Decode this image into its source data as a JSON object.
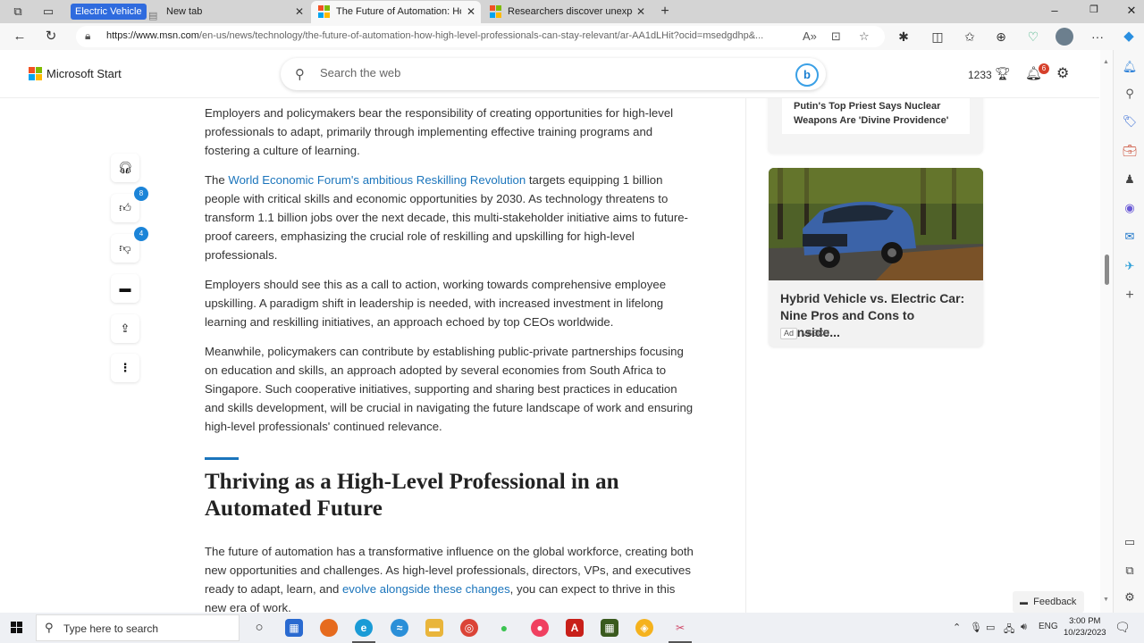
{
  "browser": {
    "tab_group_label": "Electric Vehicle",
    "tabs": [
      {
        "title": "New tab",
        "active": false
      },
      {
        "title": "The Future of Automation: How High-Level Professionals Can Stay Relevant",
        "active": true
      },
      {
        "title": "Researchers discover unexpected",
        "active": false
      }
    ],
    "new_tab_glyph": "+",
    "close_glyph": "✕",
    "window_controls": {
      "minimize": "–",
      "restore": "❐",
      "close": "✕"
    },
    "url_host": "https://www.msn.com",
    "url_path": "/en-us/news/technology/the-future-of-automation-how-high-level-professionals-can-stay-relevant/ar-AA1dLHit?ocid=msedgdhp&..."
  },
  "header": {
    "brand": "Microsoft Start",
    "search_placeholder": "Search the web",
    "points": "1233",
    "notification_count": "6"
  },
  "rail": {
    "like_count": "8",
    "dislike_count": "4"
  },
  "article": {
    "p1": "Employers and policymakers bear the responsibility of creating opportunities for high-level professionals to adapt, primarily through implementing effective training programs and fostering a culture of learning.",
    "p2_pre": "The ",
    "p2_link": "World Economic Forum's ambitious Reskilling Revolution",
    "p2_post": " targets equipping 1 billion people with critical skills and economic opportunities by 2030. As technology threatens to transform 1.1 billion jobs over the next decade, this multi-stakeholder initiative aims to future-proof careers, emphasizing the crucial role of reskilling and upskilling for high-level professionals.",
    "p3": "Employers should see this as a call to action, working towards comprehensive employee upskilling. A paradigm shift in leadership is needed, with increased investment in lifelong learning and reskilling initiatives, an approach echoed by top CEOs worldwide.",
    "p4": "Meanwhile, policymakers can contribute by establishing public-private partnerships focusing on education and skills, an approach adopted by several economies from South Africa to Singapore. Such cooperative initiatives, supporting and sharing best practices in education and skills development, will be crucial in navigating the future landscape of work and ensuring high-level professionals' continued relevance.",
    "heading": "Thriving as a High-Level Professional in an Automated Future",
    "p5_pre": "The future of automation has a transformative influence on the global workforce, creating both new opportunities and challenges. As high-level professionals, directors, VPs, and executives ready to adapt, learn, and ",
    "p5_link": "evolve alongside these changes",
    "p5_post": ", you can expect to thrive in this new era of work."
  },
  "right": {
    "news_card_title": "Putin's Top Priest Says Nuclear Weapons Are 'Divine Providence'",
    "ad_title": "Hybrid Vehicle vs. Electric Car: Nine Pros and Cons to Conside...",
    "ad_tag": "Ad",
    "ad_source": "VSECU"
  },
  "feedback_label": "Feedback",
  "taskbar": {
    "search_placeholder": "Type here to search",
    "language": "ENG",
    "time": "3:00 PM",
    "date": "10/23/2023"
  }
}
